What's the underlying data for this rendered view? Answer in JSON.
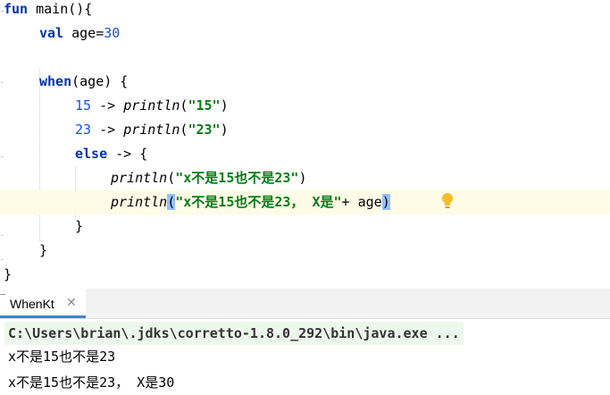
{
  "editor": {
    "lines": [
      {
        "indent": 0,
        "tokens": [
          {
            "t": "fun",
            "c": "kw"
          },
          {
            "t": " main(){",
            "c": "plain"
          }
        ]
      },
      {
        "indent": 1,
        "tokens": [
          {
            "t": "val",
            "c": "kw"
          },
          {
            "t": " age=",
            "c": "plain"
          },
          {
            "t": "30",
            "c": "num"
          }
        ]
      },
      {
        "indent": 0,
        "tokens": []
      },
      {
        "indent": 1,
        "tokens": [
          {
            "t": "when",
            "c": "kw"
          },
          {
            "t": "(age) {",
            "c": "plain"
          }
        ]
      },
      {
        "indent": 2,
        "tokens": [
          {
            "t": "15",
            "c": "num"
          },
          {
            "t": " -> ",
            "c": "plain"
          },
          {
            "t": "println",
            "c": "fn"
          },
          {
            "t": "(",
            "c": "plain"
          },
          {
            "t": "\"15\"",
            "c": "str"
          },
          {
            "t": ")",
            "c": "plain"
          }
        ]
      },
      {
        "indent": 2,
        "tokens": [
          {
            "t": "23",
            "c": "num"
          },
          {
            "t": " -> ",
            "c": "plain"
          },
          {
            "t": "println",
            "c": "fn"
          },
          {
            "t": "(",
            "c": "plain"
          },
          {
            "t": "\"23\"",
            "c": "str"
          },
          {
            "t": ")",
            "c": "plain"
          }
        ]
      },
      {
        "indent": 2,
        "tokens": [
          {
            "t": "else",
            "c": "kw"
          },
          {
            "t": " -> {",
            "c": "plain"
          }
        ]
      },
      {
        "indent": 3,
        "tokens": [
          {
            "t": "println",
            "c": "fn"
          },
          {
            "t": "(",
            "c": "plain"
          },
          {
            "t": "\"x不是15也不是23\"",
            "c": "str"
          },
          {
            "t": ")",
            "c": "plain"
          }
        ]
      },
      {
        "indent": 3,
        "current": true,
        "tokens": [
          {
            "t": "println",
            "c": "fn"
          },
          {
            "t": "(",
            "c": "plain brace-hl"
          },
          {
            "t": "\"x不是15也不是23， X是\"",
            "c": "str"
          },
          {
            "t": "+ age",
            "c": "plain"
          },
          {
            "t": ")",
            "c": "plain brace-hl"
          }
        ]
      },
      {
        "indent": 2,
        "tokens": [
          {
            "t": "}",
            "c": "plain"
          }
        ]
      },
      {
        "indent": 1,
        "tokens": [
          {
            "t": "}",
            "c": "plain"
          }
        ]
      },
      {
        "indent": 0,
        "tokens": [
          {
            "t": "}",
            "c": "plain"
          }
        ]
      }
    ]
  },
  "run_panel": {
    "tab_label": "WhenKt",
    "tab_close": "✕",
    "command": "C:\\Users\\brian\\.jdks\\corretto-1.8.0_292\\bin\\java.exe ...",
    "output": [
      "x不是15也不是23",
      "x不是15也不是23， X是30"
    ]
  },
  "colors": {
    "keyword": "#0033b3",
    "number": "#1750eb",
    "string": "#067d17",
    "current_line": "#fefbe7",
    "brace_highlight": "#93c1ff",
    "tab_underline": "#4083c9",
    "command_bg": "#edf8ec"
  },
  "icons": {
    "intention": "lightbulb-icon",
    "close": "close-icon"
  }
}
